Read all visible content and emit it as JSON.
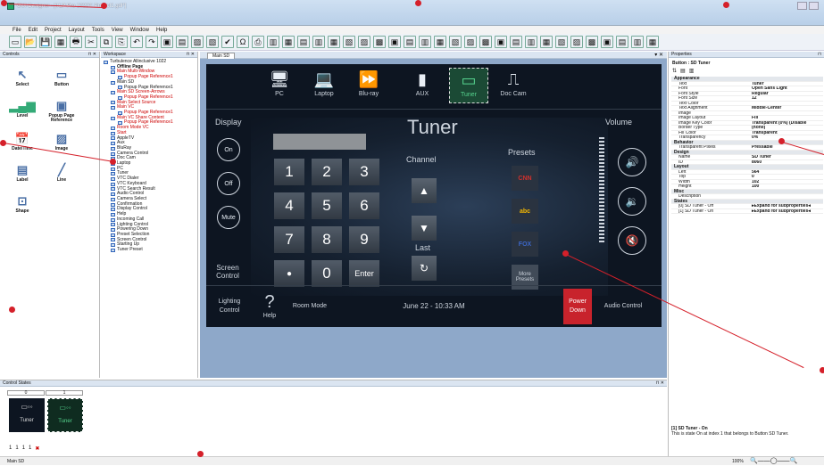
{
  "app": {
    "title": "GUI Designer - [TLP Pro 1022T: Project1.gdl*]"
  },
  "menu": [
    "File",
    "Edit",
    "Project",
    "Layout",
    "Tools",
    "View",
    "Window",
    "Help"
  ],
  "controls_panel": {
    "title": "Controls",
    "items": [
      {
        "label": "Select",
        "icon": "arrow-icon"
      },
      {
        "label": "Button",
        "icon": "button-icon"
      },
      {
        "label": "Level",
        "icon": "level-icon"
      },
      {
        "label": "Popup Page Reference",
        "icon": "popup-icon"
      },
      {
        "label": "Date/Time",
        "icon": "calendar-icon"
      },
      {
        "label": "Image",
        "icon": "image-icon"
      },
      {
        "label": "Label",
        "icon": "label-icon"
      },
      {
        "label": "Line",
        "icon": "line-icon"
      },
      {
        "label": "Shape",
        "icon": "shape-icon"
      }
    ]
  },
  "workspace_panel": {
    "title": "Workspace",
    "root": "Turbulence Allinclusive 1022",
    "items": [
      {
        "label": "Offline Page",
        "red": false,
        "indent": 1,
        "bold": true
      },
      {
        "label": "Main Multi-Window",
        "red": true,
        "indent": 1
      },
      {
        "label": "Popup Page Reference1",
        "red": true,
        "indent": 2
      },
      {
        "label": "Main SD",
        "red": false,
        "indent": 1
      },
      {
        "label": "Popup Page Reference1",
        "red": false,
        "indent": 2
      },
      {
        "label": "Main SD Screen-Arrows",
        "red": true,
        "indent": 1
      },
      {
        "label": "Popup Page Reference1",
        "red": true,
        "indent": 2
      },
      {
        "label": "Main Select Source",
        "red": true,
        "indent": 1
      },
      {
        "label": "Main VC",
        "red": true,
        "indent": 1
      },
      {
        "label": "Popup Page Reference1",
        "red": true,
        "indent": 2
      },
      {
        "label": "Main VC Share Content",
        "red": true,
        "indent": 1
      },
      {
        "label": "Popup Page Reference1",
        "red": true,
        "indent": 2
      },
      {
        "label": "Room Mode VC",
        "red": true,
        "indent": 1
      },
      {
        "label": "Start",
        "red": true,
        "indent": 1
      },
      {
        "label": "AppleTV",
        "red": false,
        "indent": 1
      },
      {
        "label": "Aux",
        "red": false,
        "indent": 1
      },
      {
        "label": "BluRay",
        "red": false,
        "indent": 1
      },
      {
        "label": "Camera Control",
        "red": false,
        "indent": 1
      },
      {
        "label": "Doc Cam",
        "red": false,
        "indent": 1
      },
      {
        "label": "Laptop",
        "red": false,
        "indent": 1
      },
      {
        "label": "PC",
        "red": false,
        "indent": 1
      },
      {
        "label": "Tuner",
        "red": false,
        "indent": 1
      },
      {
        "label": "VTC Dialer",
        "red": false,
        "indent": 1
      },
      {
        "label": "VTC Keyboard",
        "red": false,
        "indent": 1
      },
      {
        "label": "VTC Search Result",
        "red": false,
        "indent": 1
      },
      {
        "label": "Audio Control",
        "red": false,
        "indent": 1
      },
      {
        "label": "Camera Select",
        "red": false,
        "indent": 1
      },
      {
        "label": "Confirmation",
        "red": false,
        "indent": 1
      },
      {
        "label": "Display Control",
        "red": false,
        "indent": 1
      },
      {
        "label": "Help",
        "red": false,
        "indent": 1
      },
      {
        "label": "Incoming Call",
        "red": false,
        "indent": 1
      },
      {
        "label": "Lighting Control",
        "red": false,
        "indent": 1
      },
      {
        "label": "Powering Down",
        "red": false,
        "indent": 1
      },
      {
        "label": "Preset Selection",
        "red": false,
        "indent": 1
      },
      {
        "label": "Screen Control",
        "red": false,
        "indent": 1
      },
      {
        "label": "Starting Up",
        "red": false,
        "indent": 1
      },
      {
        "label": "Tuner Preset",
        "red": false,
        "indent": 1
      }
    ]
  },
  "main_tab": {
    "label": "Main SD"
  },
  "touchpanel": {
    "sources": [
      "PC",
      "Laptop",
      "Blu-ray",
      "AUX",
      "Tuner",
      "Doc Cam"
    ],
    "display_label": "Display",
    "display_buttons": [
      "On",
      "Off",
      "Mute"
    ],
    "page_title": "Tuner",
    "channel_label": "Channel",
    "last_label": "Last",
    "presets_label": "Presets",
    "presets": [
      "CNN",
      "abc",
      "FOX",
      "More Presets"
    ],
    "keypad": [
      "1",
      "2",
      "3",
      "4",
      "5",
      "6",
      "7",
      "8",
      "9",
      "●",
      "0",
      "Enter"
    ],
    "volume_label": "Volume",
    "screen_control": "Screen Control",
    "lighting_control": "Lighting Control",
    "help": "Help",
    "room_mode": "Room Mode",
    "datetime": "June 22 - 10:33 AM",
    "power_down": "Power Down",
    "audio_control": "Audio Control"
  },
  "properties": {
    "title": "Properties",
    "subject": "Button : SD Tuner",
    "rows": [
      {
        "cat": "Appearance"
      },
      {
        "k": "Text",
        "v": "Tuner"
      },
      {
        "k": "Font",
        "v": "Open Sans Light"
      },
      {
        "k": "Font Style",
        "v": "Regular"
      },
      {
        "k": "Font Size",
        "v": "12"
      },
      {
        "k": "Text Color",
        "v": ""
      },
      {
        "k": "Text Alignment",
        "v": "Middle-Center"
      },
      {
        "k": "Image",
        "v": ""
      },
      {
        "k": "Image Layout",
        "v": "Fill"
      },
      {
        "k": "Image Key Color",
        "v": "Transparent (0%) (Disable"
      },
      {
        "k": "Border Type",
        "v": "(none)"
      },
      {
        "k": "Fill Color",
        "v": "Transparent"
      },
      {
        "k": "Transparency",
        "v": "0%"
      },
      {
        "cat": "Behavior"
      },
      {
        "k": "Transparent Pixels",
        "v": "Pressable"
      },
      {
        "cat": "Design"
      },
      {
        "k": "Name",
        "v": "SD Tuner"
      },
      {
        "k": "ID",
        "v": "8060"
      },
      {
        "cat": "Layout"
      },
      {
        "k": "Left",
        "v": "564"
      },
      {
        "k": "Top",
        "v": "0"
      },
      {
        "k": "Width",
        "v": "102"
      },
      {
        "k": "Height",
        "v": "100"
      },
      {
        "cat": "Misc"
      },
      {
        "k": "Description",
        "v": ""
      },
      {
        "cat": "States"
      },
      {
        "k": "[0] SD Tuner - Off",
        "v": "▸Expand for subproperties◂"
      },
      {
        "k": "[1] SD Tuner - On",
        "v": "▸Expand for subproperties◂"
      }
    ],
    "desc_title": "[1] SD Tuner - On",
    "desc_text": "This is state On at index 1 that belongs to Button SD Tuner."
  },
  "control_states": {
    "title": "Control States",
    "indices": [
      "0",
      "1"
    ],
    "states": [
      "Tuner",
      "Tuner"
    ],
    "toolbar": [
      "1",
      "1",
      "1",
      "1"
    ]
  },
  "status": {
    "left": "Main SD",
    "zoom": "100%"
  }
}
